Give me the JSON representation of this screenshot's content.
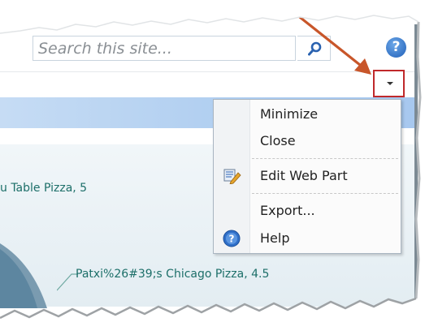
{
  "search": {
    "placeholder": "Search this site...",
    "icon": "search-icon"
  },
  "help": {
    "glyph": "?",
    "icon": "help-icon"
  },
  "webpart_menu_button": {
    "icon": "dropdown-arrow-icon",
    "highlight_color": "#c0292b"
  },
  "annotation": {
    "arrow_color": "#c8562a"
  },
  "menu": {
    "items": [
      {
        "label": "Minimize",
        "icon": ""
      },
      {
        "label": "Close",
        "icon": ""
      },
      {
        "label": "Edit Web Part",
        "icon": "edit-web-part-icon"
      },
      {
        "label": "Export...",
        "icon": ""
      },
      {
        "label": "Help",
        "icon": "help-icon"
      }
    ]
  },
  "chart": {
    "label_1": "u Table Pizza, 5",
    "label_2": "Patxi%26#39;s Chicago Pizza, 4.5",
    "text_color": "#1d6f69"
  }
}
